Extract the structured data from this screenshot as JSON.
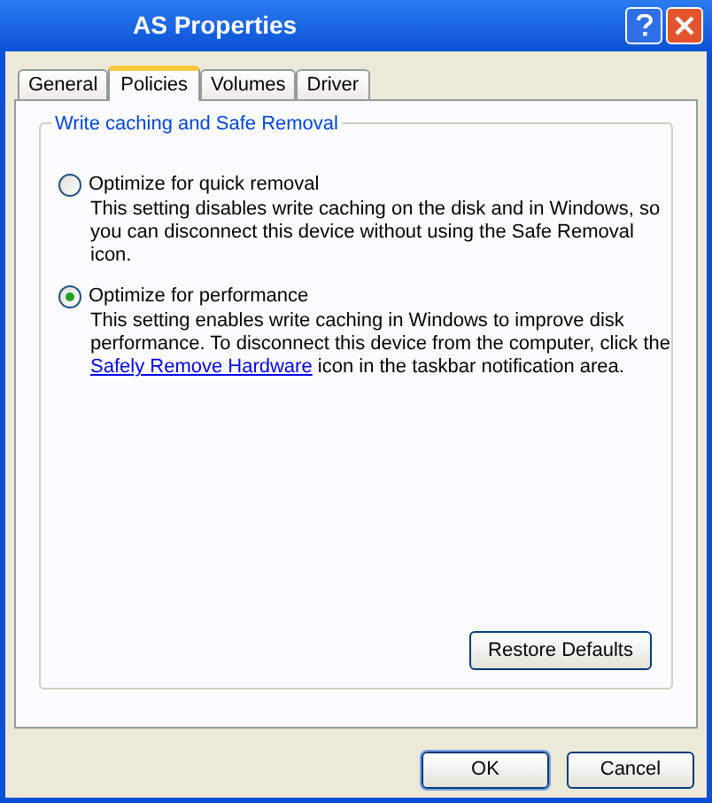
{
  "window": {
    "title": "AS Properties"
  },
  "tabs": [
    {
      "label": "General",
      "selected": false
    },
    {
      "label": "Policies",
      "selected": true
    },
    {
      "label": "Volumes",
      "selected": false
    },
    {
      "label": "Driver",
      "selected": false
    }
  ],
  "group": {
    "title": "Write caching and Safe Removal",
    "options": [
      {
        "label": "Optimize for quick removal",
        "selected": false,
        "description": [
          {
            "kind": "text",
            "text": "This setting disables write caching on the disk and in Windows, so you can disconnect this device without using the Safe Removal icon."
          }
        ]
      },
      {
        "label": "Optimize for performance",
        "selected": true,
        "description": [
          {
            "kind": "text",
            "text": "This setting enables write caching in Windows to improve disk performance. To disconnect this device from the computer, click the "
          },
          {
            "kind": "link",
            "text": "Safely Remove Hardware"
          },
          {
            "kind": "text",
            "text": " icon in the taskbar notification area."
          }
        ]
      }
    ]
  },
  "restore_button": "Restore Defaults",
  "buttons": [
    "OK",
    "Cancel"
  ]
}
